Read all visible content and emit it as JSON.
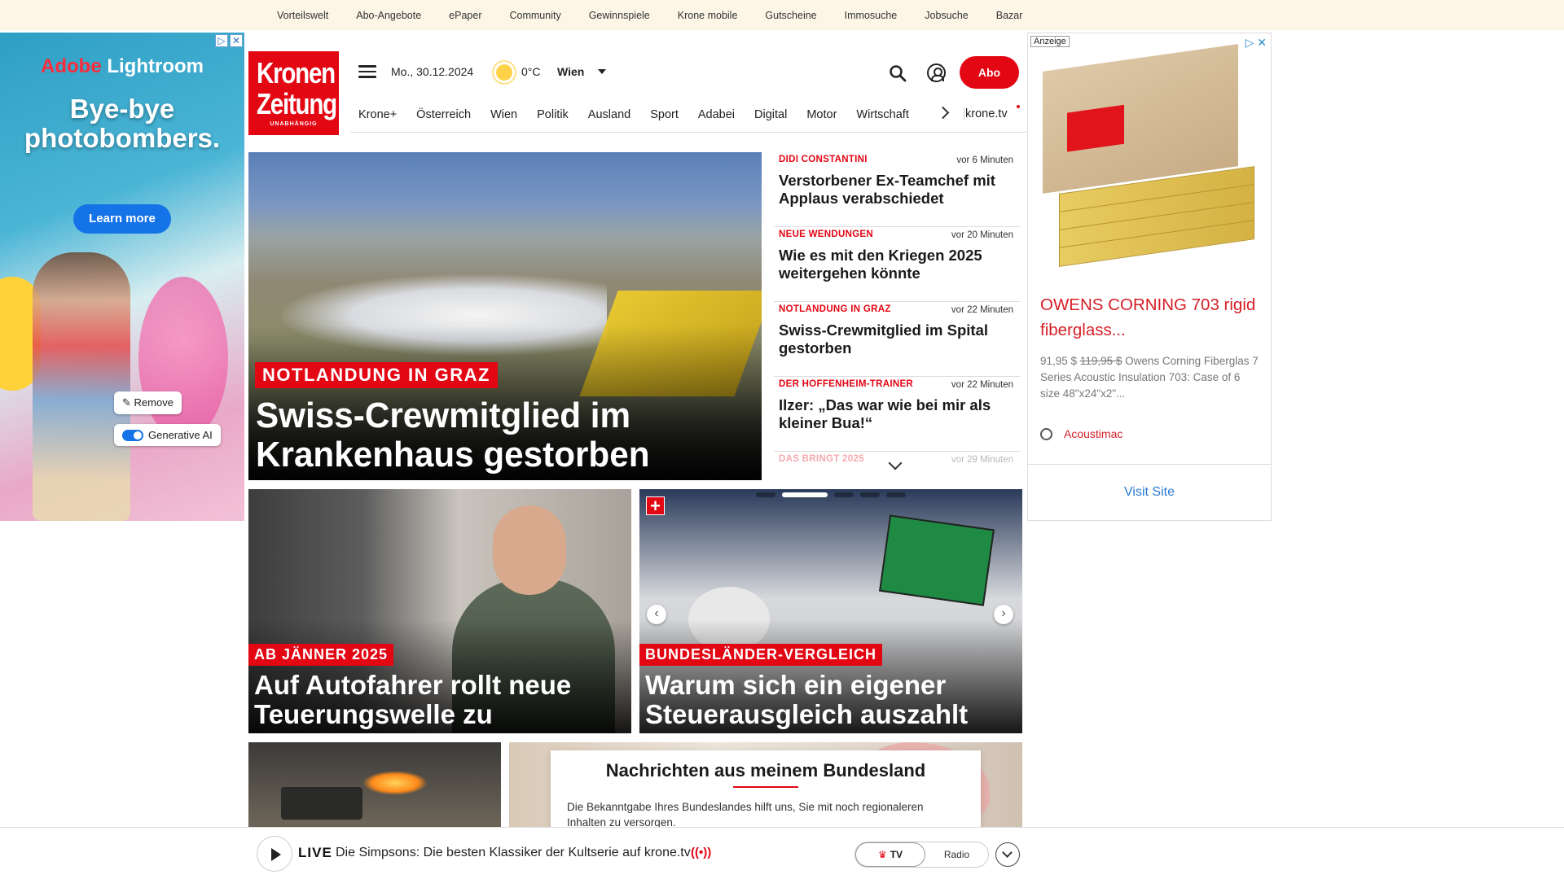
{
  "topbar": {
    "links": [
      "Vorteilswelt",
      "Abo-Angebote",
      "ePaper",
      "Community",
      "Gewinnspiele",
      "Krone mobile",
      "Gutscheine",
      "Immosuche",
      "Jobsuche",
      "Bazar"
    ]
  },
  "left_ad": {
    "brand_adobe": "Adobe",
    "brand_product": "Lightroom",
    "headline": "Bye-bye photobombers.",
    "cta": "Learn more",
    "chip_remove": "Remove",
    "chip_genai": "Generative AI"
  },
  "header": {
    "logo_line1": "Kronen",
    "logo_line2": "Zeitung",
    "logo_tagline": "UNABHÄNGIG",
    "date": "Mo., 30.12.2024",
    "temperature": "0°C",
    "city": "Wien",
    "abo_label": "Abo"
  },
  "nav": {
    "items": [
      "Krone+",
      "Österreich",
      "Wien",
      "Politik",
      "Ausland",
      "Sport",
      "Adabei",
      "Digital",
      "Motor",
      "Wirtschaft"
    ],
    "pinned": "krone.tv"
  },
  "hero": {
    "kicker": "NOTLANDUNG IN GRAZ",
    "title": "Swiss-Crewmitglied im Krankenhaus gestorben"
  },
  "ticker": [
    {
      "kicker": "DIDI CONSTANTINI",
      "time": "vor 6 Minuten",
      "headline": "Verstorbener Ex-Teamchef mit Applaus verabschiedet"
    },
    {
      "kicker": "NEUE WENDUNGEN",
      "time": "vor 20 Minuten",
      "headline": "Wie es mit den Kriegen 2025 weitergehen könnte"
    },
    {
      "kicker": "NOTLANDUNG IN GRAZ",
      "time": "vor 22 Minuten",
      "headline": "Swiss-Crewmitglied im Spital gestorben"
    },
    {
      "kicker": "DER HOFFENHEIM-TRAINER",
      "time": "vor 22 Minuten",
      "headline": "Ilzer: „Das war wie bei mir als kleiner Bua!“"
    },
    {
      "kicker": "DAS BRINGT 2025",
      "time": "vor 29 Minuten",
      "headline": ""
    }
  ],
  "tiles": [
    {
      "kicker": "AB JÄNNER 2025",
      "title": "Auf Autofahrer rollt neue Teuerungswelle zu"
    },
    {
      "kicker": "BUNDESLÄNDER-VERGLEICH",
      "title": "Warum sich ein eigener Steuerausgleich auszahlt",
      "badge": "+"
    }
  ],
  "bundesland": {
    "heading": "Nachrichten aus meinem Bundesland",
    "text": "Die Bekanntgabe Ihres Bundeslandes hilft uns, Sie mit noch regionaleren Inhalten zu versorgen."
  },
  "right_ad": {
    "label": "Anzeige",
    "title": "OWENS CORNING 703 rigid fiberglass...",
    "price_new": "91,95 $",
    "price_old": "119,95 $",
    "description": "Owens Corning Fiberglas 7 Series Acoustic Insulation 703: Case of 6 size 48\"x24\"x2\"...",
    "vendor": "Acoustimac",
    "cta": "Visit Site"
  },
  "live_bar": {
    "live_label": "LIVE",
    "title": "Die Simpsons: Die besten Klassiker der Kultserie auf krone.tv",
    "tv_label": "TV",
    "radio_label": "Radio"
  },
  "colors": {
    "brand_red": "#e30613",
    "topbar_bg": "#fdf6e7",
    "ad_red": "#d51e26",
    "ad_link_blue": "#2a7ad1"
  }
}
